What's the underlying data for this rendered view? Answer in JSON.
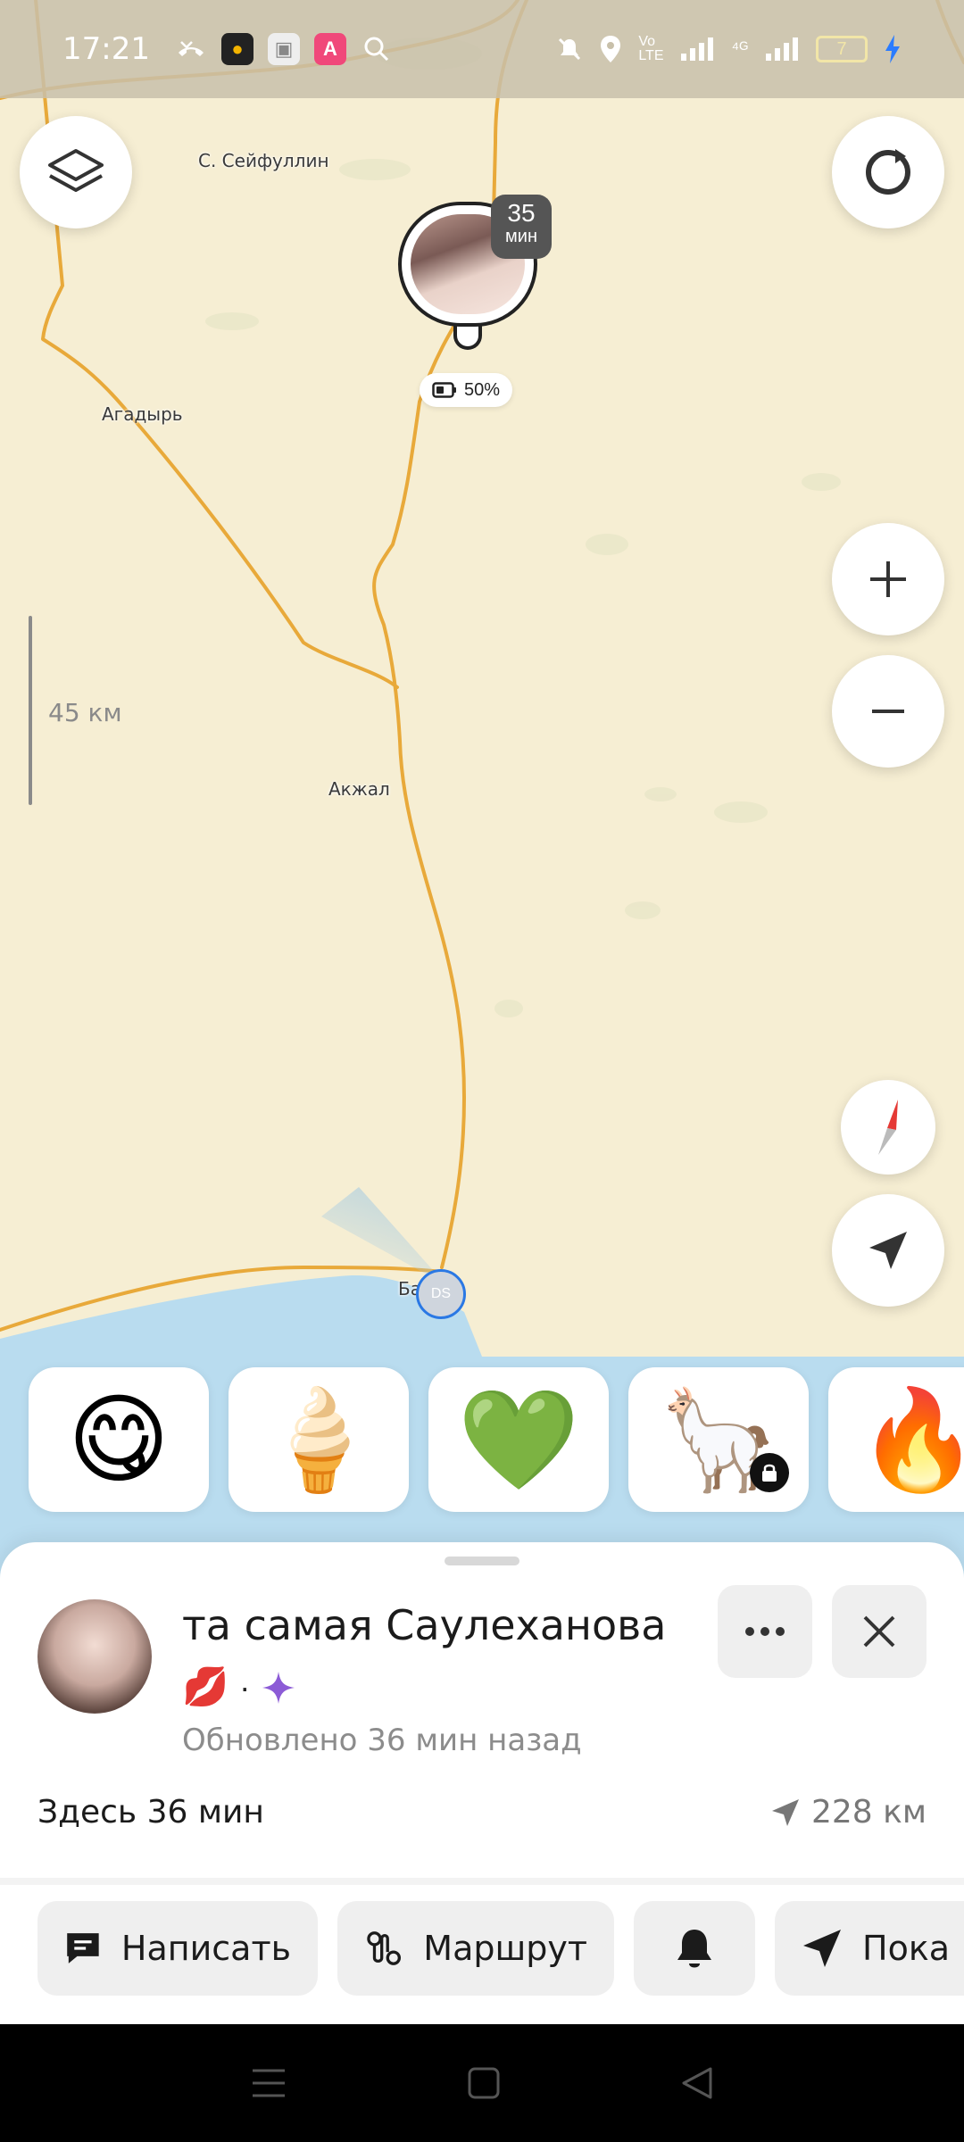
{
  "status_bar": {
    "time": "17:21",
    "battery_level": "7"
  },
  "map": {
    "places": {
      "seifullin": "С. Сейфуллин",
      "agadyr": "Агадырь",
      "akzhal": "Акжал",
      "partial": "Ба"
    },
    "scale_label": "45 км",
    "friend_pin": {
      "minutes": "35",
      "minutes_unit": "мин",
      "battery": "50%"
    },
    "me_initials": "DS"
  },
  "reactions": [
    {
      "icon": "smiling-face-icon",
      "glyph": "😋"
    },
    {
      "icon": "ice-cream-icon",
      "glyph": "🍦"
    },
    {
      "icon": "green-heart-icon",
      "glyph": "💚"
    },
    {
      "icon": "llama-icon",
      "glyph": "🦙",
      "locked": true
    },
    {
      "icon": "fire-icon",
      "glyph": "🔥"
    }
  ],
  "profile": {
    "name": "та самая Саулеханова",
    "badge_separator": "·",
    "updated": "Обновлено 36 мин назад",
    "here_for": "Здесь 36 мин",
    "distance": "228 км"
  },
  "actions": {
    "write": "Написать",
    "route": "Маршрут",
    "show": "Пока"
  },
  "colors": {
    "map_bg": "#f6eed3",
    "road": "#e8a93a",
    "water": "#b9dcef",
    "accent_blue": "#2a78e4"
  }
}
